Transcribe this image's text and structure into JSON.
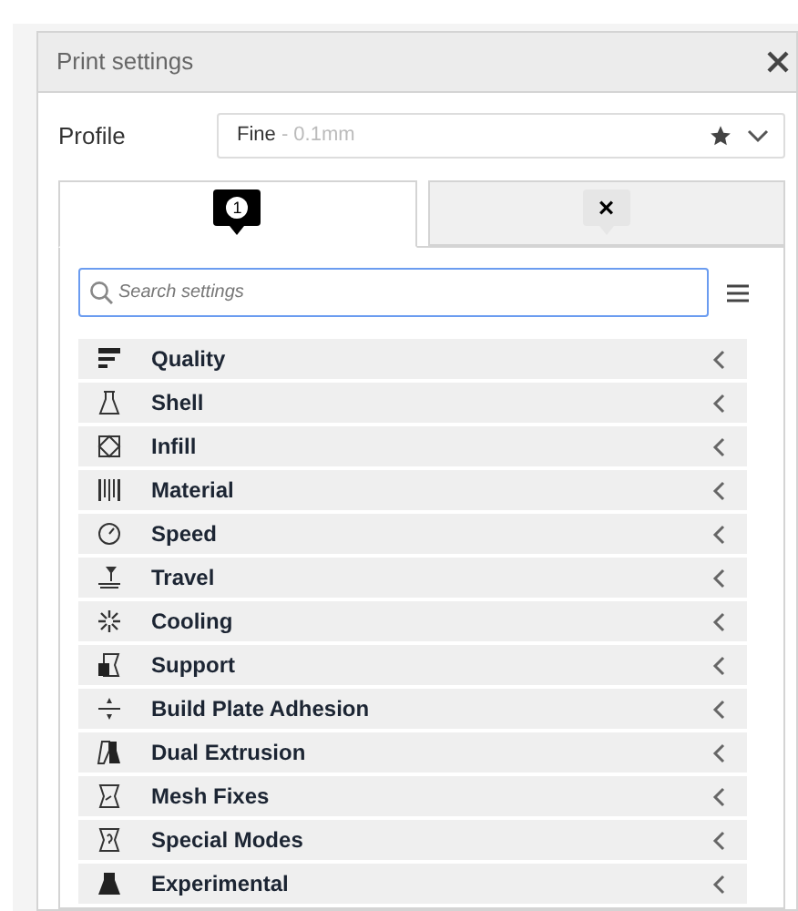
{
  "window": {
    "title": "Print settings"
  },
  "profile": {
    "label": "Profile",
    "value": "Fine",
    "detail": " - 0.1mm"
  },
  "tabs": [
    {
      "badge": "1",
      "selected": true
    },
    {
      "badge": "×",
      "selected": false
    }
  ],
  "search": {
    "placeholder": "Search settings"
  },
  "categories": [
    {
      "label": "Quality"
    },
    {
      "label": "Shell"
    },
    {
      "label": "Infill"
    },
    {
      "label": "Material"
    },
    {
      "label": "Speed"
    },
    {
      "label": "Travel"
    },
    {
      "label": "Cooling"
    },
    {
      "label": "Support"
    },
    {
      "label": "Build Plate Adhesion"
    },
    {
      "label": "Dual Extrusion"
    },
    {
      "label": "Mesh Fixes"
    },
    {
      "label": "Special Modes"
    },
    {
      "label": "Experimental"
    }
  ]
}
